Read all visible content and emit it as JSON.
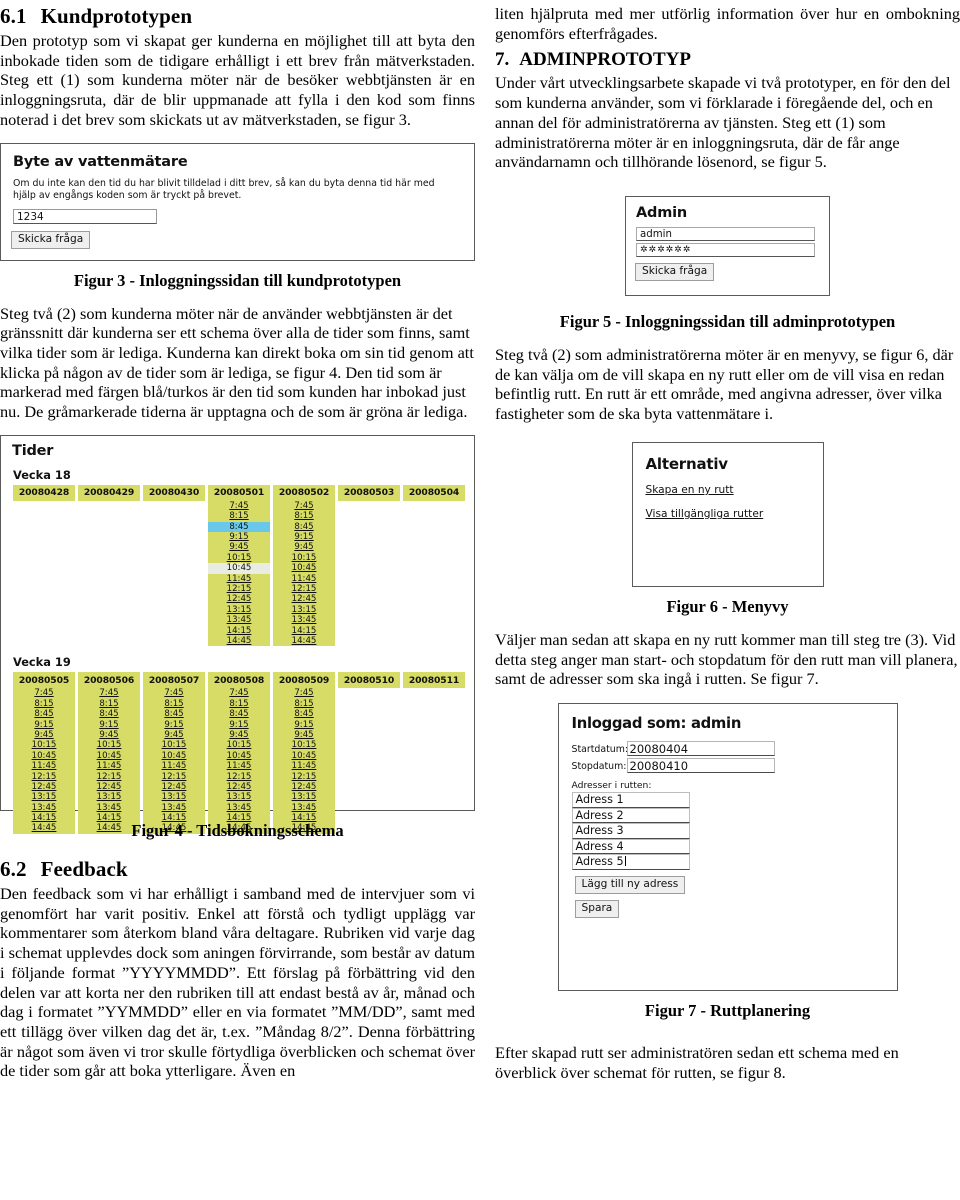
{
  "left": {
    "section1": {
      "number": "6.1",
      "title": "Kundprototypen",
      "paragraph": "Den prototyp som vi skapat ger kunderna en möjlighet till att byta den inbokade tiden som de tidigare erhålligt i ett brev från mätverkstaden. Steg ett (1) som kunderna möter när de besöker webbtjänsten är en inloggningsruta, där de blir uppmanade att fylla i den kod som finns noterad i det brev som skickats ut av mätverkstaden, se figur 3."
    },
    "figure3": {
      "title": "Byte av vattenmätare",
      "hint": "Om du inte kan den tid du har blivit tilldelad i ditt brev, så kan du byta denna tid här med hjälp av engångs koden som är tryckt på brevet.",
      "code_value": "1234",
      "submit_label": "Skicka fråga",
      "caption": "Figur 3 - Inloggningssidan till kundprototypen"
    },
    "paragraph2": "Steg två (2) som kunderna möter när de använder webbtjänsten är det gränssnitt där kunderna ser ett schema över alla de tider som finns, samt vilka tider som är lediga. Kunderna kan direkt boka om sin tid genom att klicka på någon av de tider som är lediga, se figur 4. Den tid som är markerad med färgen blå/turkos är den tid som kunden har inbokad just nu. De gråmarkerade tiderna är upptagna och de som är gröna är lediga.",
    "figure4": {
      "title": "Tider",
      "caption": "Figur 4 - Tidsbokningsschema"
    },
    "section2": {
      "number": "6.2",
      "title": "Feedback",
      "paragraph": "Den feedback som vi har erhålligt i samband med de intervjuer som vi genomfört har varit positiv. Enkel att förstå och tydligt upplägg var kommentarer som återkom bland våra deltagare. Rubriken vid varje dag i schemat upplevdes dock som aningen förvirrande, som består av datum i följande format ”YYYYMMDD”. Ett förslag på förbättring vid den delen var att korta ner den rubriken till att endast bestå av år, månad och dag i formatet ”YYMMDD” eller en via formatet ”MM/DD”, samt med ett tillägg över vilken dag det är, t.ex. ”Måndag 8/2”. Denna förbättring är något som även vi tror skulle förtydliga överblicken och schemat över de tider som går att boka ytterligare. Även en"
    }
  },
  "right": {
    "paragraph_top": "liten hjälpruta med mer utförlig information över hur en ombokning genomförs efterfrågades.",
    "section7": {
      "number": "7.",
      "title": "ADMINPROTOTYP",
      "paragraph": "Under vårt utvecklingsarbete skapade vi två prototyper, en för den del som kunderna använder, som vi förklarade i föregående del, och en annan del för administratörerna av tjänsten. Steg ett (1) som administratörerna möter är en inloggningsruta, där de får ange användarnamn och tillhörande lösenord, se figur 5."
    },
    "figure5": {
      "title": "Admin",
      "username_value": "admin",
      "password_value": "✲✲✲✲✲✲",
      "submit_label": "Skicka fråga",
      "caption": "Figur 5 - Inloggningssidan till adminprototypen"
    },
    "paragraph2": "Steg två (2) som administratörerna möter är en menyvy, se figur 6, där de kan välja om de vill skapa en ny rutt eller om de vill visa en redan befintlig rutt. En rutt är ett område, med angivna adresser, över vilka fastigheter som de ska byta vattenmätare i.",
    "figure6": {
      "title": "Alternativ",
      "link1": "Skapa en ny rutt",
      "link2": "Visa tillgängliga rutter",
      "caption": "Figur 6 - Menyvy"
    },
    "paragraph3": "Väljer man sedan att skapa en ny rutt kommer man till steg tre (3). Vid detta steg anger man start- och stopdatum för den rutt man vill planera, samt de adresser som ska ingå i rutten. Se figur 7.",
    "figure7": {
      "title": "Inloggad som: admin",
      "start_label": "Startdatum:",
      "start_value": "20080404",
      "stop_label": "Stopdatum:",
      "stop_value": "20080410",
      "addresses_label": "Adresser i rutten:",
      "addresses": [
        "Adress 1",
        "Adress 2",
        "Adress 3",
        "Adress 4",
        "Adress 5"
      ],
      "add_label": "Lägg till ny adress",
      "save_label": "Spara",
      "caption": "Figur 7 - Ruttplanering"
    },
    "paragraph4": "Efter skapad rutt ser administratören sedan ett schema med en överblick över schemat för rutten, se figur 8."
  },
  "colors": {
    "slot_free": "#d6dc66",
    "slot_booked": "#69c7ea",
    "slot_taken": "#e9ece2",
    "frame_border": "#5a5a5a"
  },
  "chart_data": {
    "type": "table",
    "title": "Tider",
    "weeks": [
      {
        "label": "Vecka 18",
        "days": [
          {
            "date": "20080428",
            "slots": []
          },
          {
            "date": "20080429",
            "slots": []
          },
          {
            "date": "20080430",
            "slots": []
          },
          {
            "date": "20080501",
            "slots": [
              {
                "t": "7:45",
                "s": "free"
              },
              {
                "t": "8:15",
                "s": "free"
              },
              {
                "t": "8:45",
                "s": "booked"
              },
              {
                "t": "9:15",
                "s": "free"
              },
              {
                "t": "9:45",
                "s": "free"
              },
              {
                "t": "10:15",
                "s": "free"
              },
              {
                "t": "10:45",
                "s": "taken"
              },
              {
                "t": "11:45",
                "s": "free"
              },
              {
                "t": "12:15",
                "s": "free"
              },
              {
                "t": "12:45",
                "s": "free"
              },
              {
                "t": "13:15",
                "s": "free"
              },
              {
                "t": "13:45",
                "s": "free"
              },
              {
                "t": "14:15",
                "s": "free"
              },
              {
                "t": "14:45",
                "s": "free"
              }
            ]
          },
          {
            "date": "20080502",
            "slots": [
              {
                "t": "7:45",
                "s": "free"
              },
              {
                "t": "8:15",
                "s": "free"
              },
              {
                "t": "8:45",
                "s": "free"
              },
              {
                "t": "9:15",
                "s": "free"
              },
              {
                "t": "9:45",
                "s": "free"
              },
              {
                "t": "10:15",
                "s": "free"
              },
              {
                "t": "10:45",
                "s": "free"
              },
              {
                "t": "11:45",
                "s": "free"
              },
              {
                "t": "12:15",
                "s": "free"
              },
              {
                "t": "12:45",
                "s": "free"
              },
              {
                "t": "13:15",
                "s": "free"
              },
              {
                "t": "13:45",
                "s": "free"
              },
              {
                "t": "14:15",
                "s": "free"
              },
              {
                "t": "14:45",
                "s": "free"
              }
            ]
          },
          {
            "date": "20080503",
            "slots": []
          },
          {
            "date": "20080504",
            "slots": []
          }
        ]
      },
      {
        "label": "Vecka 19",
        "days": [
          {
            "date": "20080505",
            "slots": [
              {
                "t": "7:45",
                "s": "free"
              },
              {
                "t": "8:15",
                "s": "free"
              },
              {
                "t": "8:45",
                "s": "free"
              },
              {
                "t": "9:15",
                "s": "free"
              },
              {
                "t": "9:45",
                "s": "free"
              },
              {
                "t": "10:15",
                "s": "free"
              },
              {
                "t": "10:45",
                "s": "free"
              },
              {
                "t": "11:45",
                "s": "free"
              },
              {
                "t": "12:15",
                "s": "free"
              },
              {
                "t": "12:45",
                "s": "free"
              },
              {
                "t": "13:15",
                "s": "free"
              },
              {
                "t": "13:45",
                "s": "free"
              },
              {
                "t": "14:15",
                "s": "free"
              },
              {
                "t": "14:45",
                "s": "free"
              }
            ]
          },
          {
            "date": "20080506",
            "slots": [
              {
                "t": "7:45",
                "s": "free"
              },
              {
                "t": "8:15",
                "s": "free"
              },
              {
                "t": "8:45",
                "s": "free"
              },
              {
                "t": "9:15",
                "s": "free"
              },
              {
                "t": "9:45",
                "s": "free"
              },
              {
                "t": "10:15",
                "s": "free"
              },
              {
                "t": "10:45",
                "s": "free"
              },
              {
                "t": "11:45",
                "s": "free"
              },
              {
                "t": "12:15",
                "s": "free"
              },
              {
                "t": "12:45",
                "s": "free"
              },
              {
                "t": "13:15",
                "s": "free"
              },
              {
                "t": "13:45",
                "s": "free"
              },
              {
                "t": "14:15",
                "s": "free"
              },
              {
                "t": "14:45",
                "s": "free"
              }
            ]
          },
          {
            "date": "20080507",
            "slots": [
              {
                "t": "7:45",
                "s": "free"
              },
              {
                "t": "8:15",
                "s": "free"
              },
              {
                "t": "8:45",
                "s": "free"
              },
              {
                "t": "9:15",
                "s": "free"
              },
              {
                "t": "9:45",
                "s": "free"
              },
              {
                "t": "10:15",
                "s": "free"
              },
              {
                "t": "10:45",
                "s": "free"
              },
              {
                "t": "11:45",
                "s": "free"
              },
              {
                "t": "12:15",
                "s": "free"
              },
              {
                "t": "12:45",
                "s": "free"
              },
              {
                "t": "13:15",
                "s": "free"
              },
              {
                "t": "13:45",
                "s": "free"
              },
              {
                "t": "14:15",
                "s": "free"
              },
              {
                "t": "14:45",
                "s": "free"
              }
            ]
          },
          {
            "date": "20080508",
            "slots": [
              {
                "t": "7:45",
                "s": "free"
              },
              {
                "t": "8:15",
                "s": "free"
              },
              {
                "t": "8:45",
                "s": "free"
              },
              {
                "t": "9:15",
                "s": "free"
              },
              {
                "t": "9:45",
                "s": "free"
              },
              {
                "t": "10:15",
                "s": "free"
              },
              {
                "t": "10:45",
                "s": "free"
              },
              {
                "t": "11:45",
                "s": "free"
              },
              {
                "t": "12:15",
                "s": "free"
              },
              {
                "t": "12:45",
                "s": "free"
              },
              {
                "t": "13:15",
                "s": "free"
              },
              {
                "t": "13:45",
                "s": "free"
              },
              {
                "t": "14:15",
                "s": "free"
              },
              {
                "t": "14:45",
                "s": "free"
              }
            ]
          },
          {
            "date": "20080509",
            "slots": [
              {
                "t": "7:45",
                "s": "free"
              },
              {
                "t": "8:15",
                "s": "free"
              },
              {
                "t": "8:45",
                "s": "free"
              },
              {
                "t": "9:15",
                "s": "free"
              },
              {
                "t": "9:45",
                "s": "free"
              },
              {
                "t": "10:15",
                "s": "free"
              },
              {
                "t": "10:45",
                "s": "free"
              },
              {
                "t": "11:45",
                "s": "free"
              },
              {
                "t": "12:15",
                "s": "free"
              },
              {
                "t": "12:45",
                "s": "free"
              },
              {
                "t": "13:15",
                "s": "free"
              },
              {
                "t": "13:45",
                "s": "free"
              },
              {
                "t": "14:15",
                "s": "free"
              },
              {
                "t": "14:45",
                "s": "free"
              }
            ]
          },
          {
            "date": "20080510",
            "slots": []
          },
          {
            "date": "20080511",
            "slots": []
          }
        ]
      }
    ]
  }
}
